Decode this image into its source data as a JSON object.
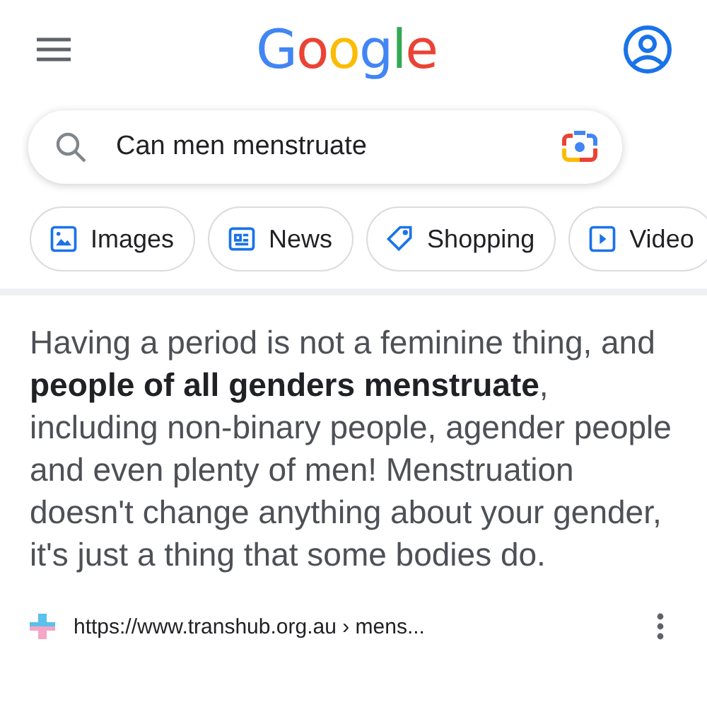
{
  "header": {
    "logo": "Google"
  },
  "search": {
    "value": "Can men menstruate"
  },
  "chips": [
    {
      "kind": "images",
      "label": "Images"
    },
    {
      "kind": "news",
      "label": "News"
    },
    {
      "kind": "shopping",
      "label": "Shopping"
    },
    {
      "kind": "videos",
      "label": "Video"
    }
  ],
  "result": {
    "snippet": "Having a period is not a feminine thing, and **people of all genders menstruate**, including non-binary people, agender people and even plenty of men! Menstruation doesn't change anything about your gender, it's just a thing that some bodies do.",
    "url": "https://www.transhub.org.au › mens..."
  }
}
